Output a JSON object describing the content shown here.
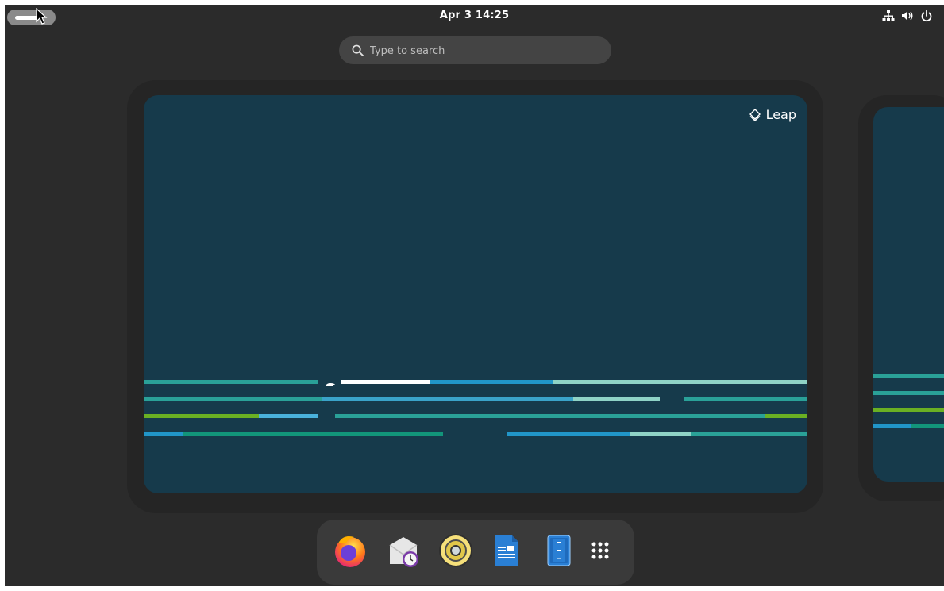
{
  "topbar": {
    "clock": "Apr 3  14:25",
    "tray_icons": [
      "network-icon",
      "volume-icon",
      "power-icon"
    ]
  },
  "search": {
    "placeholder": "Type to search",
    "value": ""
  },
  "workspace": {
    "label": "Leap",
    "background_color": "#163a4b"
  },
  "dock": {
    "apps": [
      "firefox-icon",
      "evolution-mail-icon",
      "rhythmbox-icon",
      "libreoffice-writer-icon",
      "file-archiver-icon",
      "show-apps-icon"
    ]
  },
  "colors": {
    "panel": "#2b2b2b",
    "teal": "#2aa198",
    "blue": "#2196c9",
    "light_teal": "#8fd3c6",
    "green": "#6ab023"
  }
}
